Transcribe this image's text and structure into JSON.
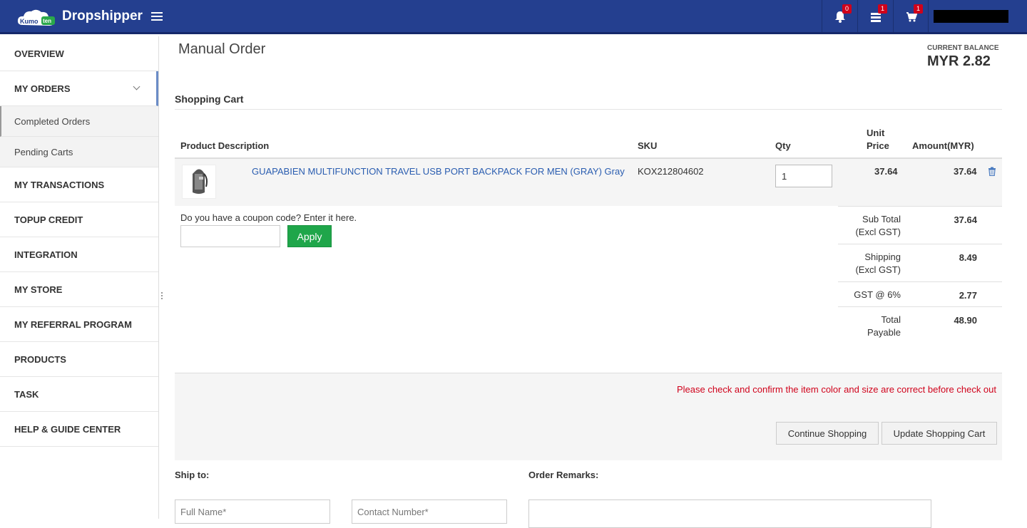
{
  "header": {
    "brand": "Dropshipper",
    "logo_text": "Kumoten",
    "notifications_count": "0",
    "messages_count": "1",
    "cart_count": "1"
  },
  "sidebar": {
    "items": [
      {
        "label": "OVERVIEW"
      },
      {
        "label": "MY ORDERS"
      },
      {
        "label": "MY TRANSACTIONS"
      },
      {
        "label": "TOPUP CREDIT"
      },
      {
        "label": "INTEGRATION"
      },
      {
        "label": "MY STORE"
      },
      {
        "label": "MY REFERRAL PROGRAM"
      },
      {
        "label": "PRODUCTS"
      },
      {
        "label": "TASK"
      },
      {
        "label": "HELP & GUIDE CENTER"
      }
    ],
    "sub_items": [
      {
        "label": "Completed Orders"
      },
      {
        "label": "Pending Carts"
      }
    ]
  },
  "page": {
    "title": "Manual Order",
    "balance_label": "CURRENT BALANCE",
    "balance_value": "MYR 2.82"
  },
  "cart": {
    "title": "Shopping Cart",
    "headers": {
      "product": "Product Description",
      "sku": "SKU",
      "qty": "Qty",
      "unit_price_1": "Unit",
      "unit_price_2": "Price",
      "amount": "Amount(MYR)"
    },
    "item": {
      "name": "GUAPABIEN MULTIFUNCTION TRAVEL USB PORT BACKPACK FOR MEN (GRAY) Gray",
      "sku": "KOX212804602",
      "qty": "1",
      "unit_price": "37.64",
      "amount": "37.64"
    },
    "coupon_label": "Do you have a coupon code? Enter it here.",
    "apply_label": "Apply",
    "totals": [
      {
        "label1": "Sub Total",
        "label2": "(Excl GST)",
        "value": "37.64"
      },
      {
        "label1": "Shipping",
        "label2": "(Excl GST)",
        "value": "8.49"
      },
      {
        "label1": "GST @ 6%",
        "label2": "",
        "value": "2.77"
      },
      {
        "label1": "Total",
        "label2": "Payable",
        "value": "48.90"
      }
    ],
    "warning": "Please check and confirm the item color and size are correct before check out",
    "continue_label": "Continue Shopping",
    "update_label": "Update Shopping Cart"
  },
  "shipping": {
    "ship_to_label": "Ship to:",
    "remarks_label": "Order Remarks:",
    "full_name_placeholder": "Full Name*",
    "contact_placeholder": "Contact Number*"
  },
  "colors": {
    "topbar": "#243f8f",
    "apply_green": "#1fa64a",
    "warning_red": "#d0021b",
    "link_blue": "#2a5db0"
  }
}
